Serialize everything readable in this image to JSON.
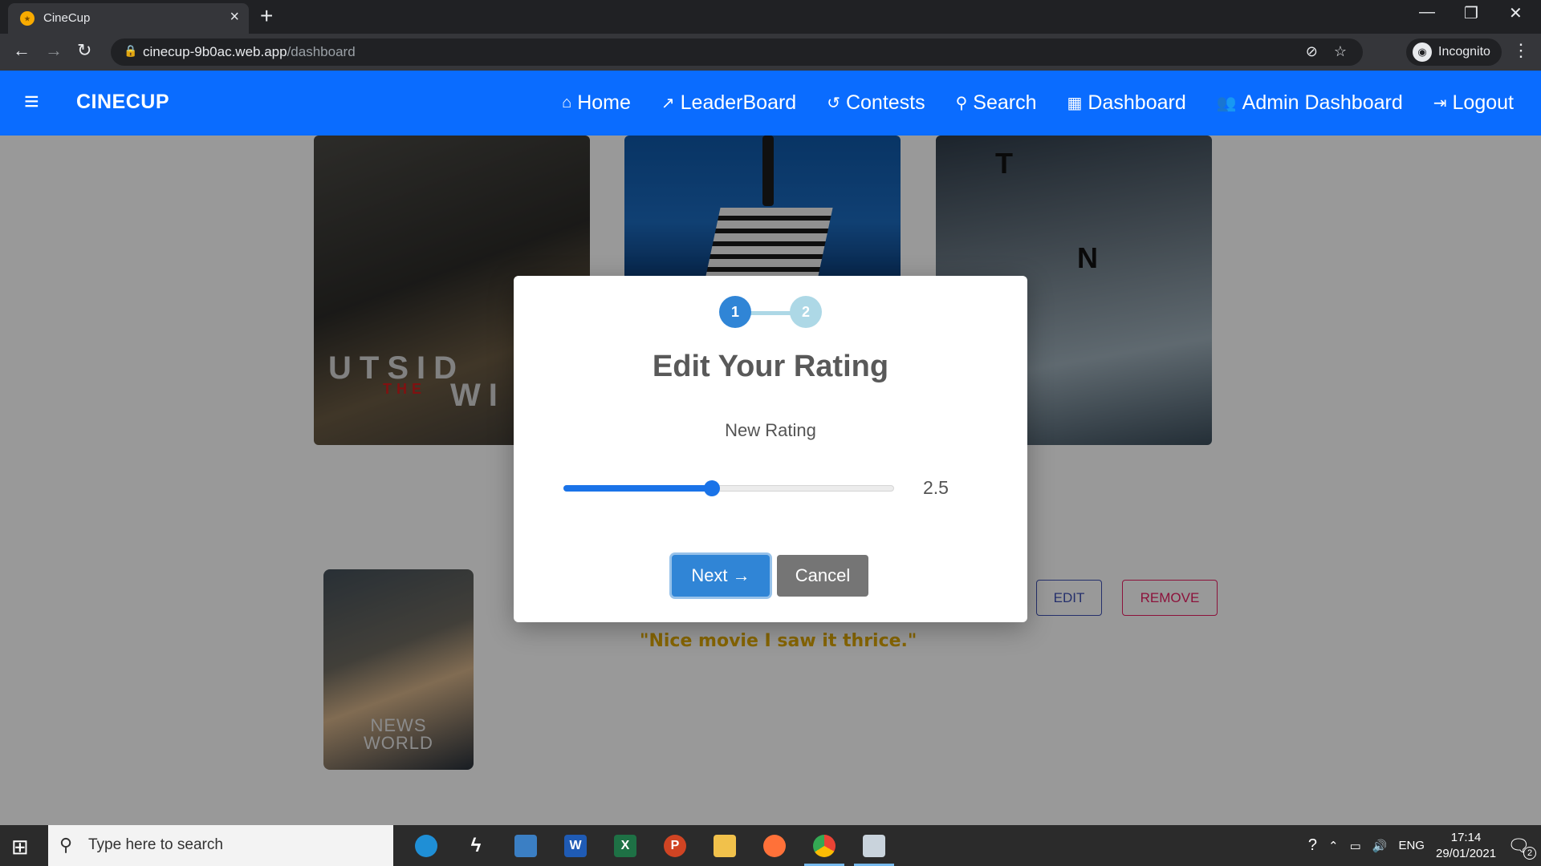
{
  "browser": {
    "tab_title": "CineCup",
    "tab_close": "×",
    "new_tab": "+",
    "url_host": "cinecup-9b0ac.web.app",
    "url_path": "/dashboard",
    "profile_label": "Incognito"
  },
  "app": {
    "brand": "CINECUP",
    "nav": [
      {
        "label": "Home",
        "icon": "home-icon"
      },
      {
        "label": "LeaderBoard",
        "icon": "trending-icon"
      },
      {
        "label": "Contests",
        "icon": "history-icon"
      },
      {
        "label": "Search",
        "icon": "search-icon"
      },
      {
        "label": "Dashboard",
        "icon": "dashboard-icon"
      },
      {
        "label": "Admin Dashboard",
        "icon": "people-icon"
      },
      {
        "label": "Logout",
        "icon": "logout-icon"
      }
    ]
  },
  "background": {
    "poster1_word": "UTSID",
    "poster1_the": "THE",
    "poster1_wi": "WI",
    "poster3_t1": "T",
    "poster3_t2": "N",
    "news_poster_line1": "NEWS",
    "news_poster_line2": "WORLD",
    "review_quote": "\"Nice movie I saw it thrice.\"",
    "edit_label": "EDIT",
    "remove_label": "REMOVE"
  },
  "modal": {
    "step1": "1",
    "step2": "2",
    "current_step": 1,
    "title": "Edit Your Rating",
    "field_label": "New Rating",
    "rating_value": "2.5",
    "rating_fraction": 0.45,
    "next_label": "Next →",
    "cancel_label": "Cancel"
  },
  "taskbar": {
    "search_placeholder": "Type here to search",
    "apps": [
      "edge-icon",
      "terminal-icon",
      "snip-icon",
      "word-icon",
      "excel-icon",
      "powerpoint-icon",
      "explorer-icon",
      "firefox-icon",
      "chrome-icon",
      "remote-desktop-icon"
    ],
    "app_letters": {
      "word": "W",
      "excel": "X",
      "powerpoint": "P"
    },
    "language": "ENG",
    "time": "17:14",
    "date": "29/01/2021",
    "notification_count": "2"
  },
  "colors": {
    "nav_bg": "#0a6cff",
    "primary": "#3085d6",
    "cancel": "#757575",
    "quote": "#e0a800",
    "edit": "#3f51b5",
    "remove": "#e91e63"
  }
}
